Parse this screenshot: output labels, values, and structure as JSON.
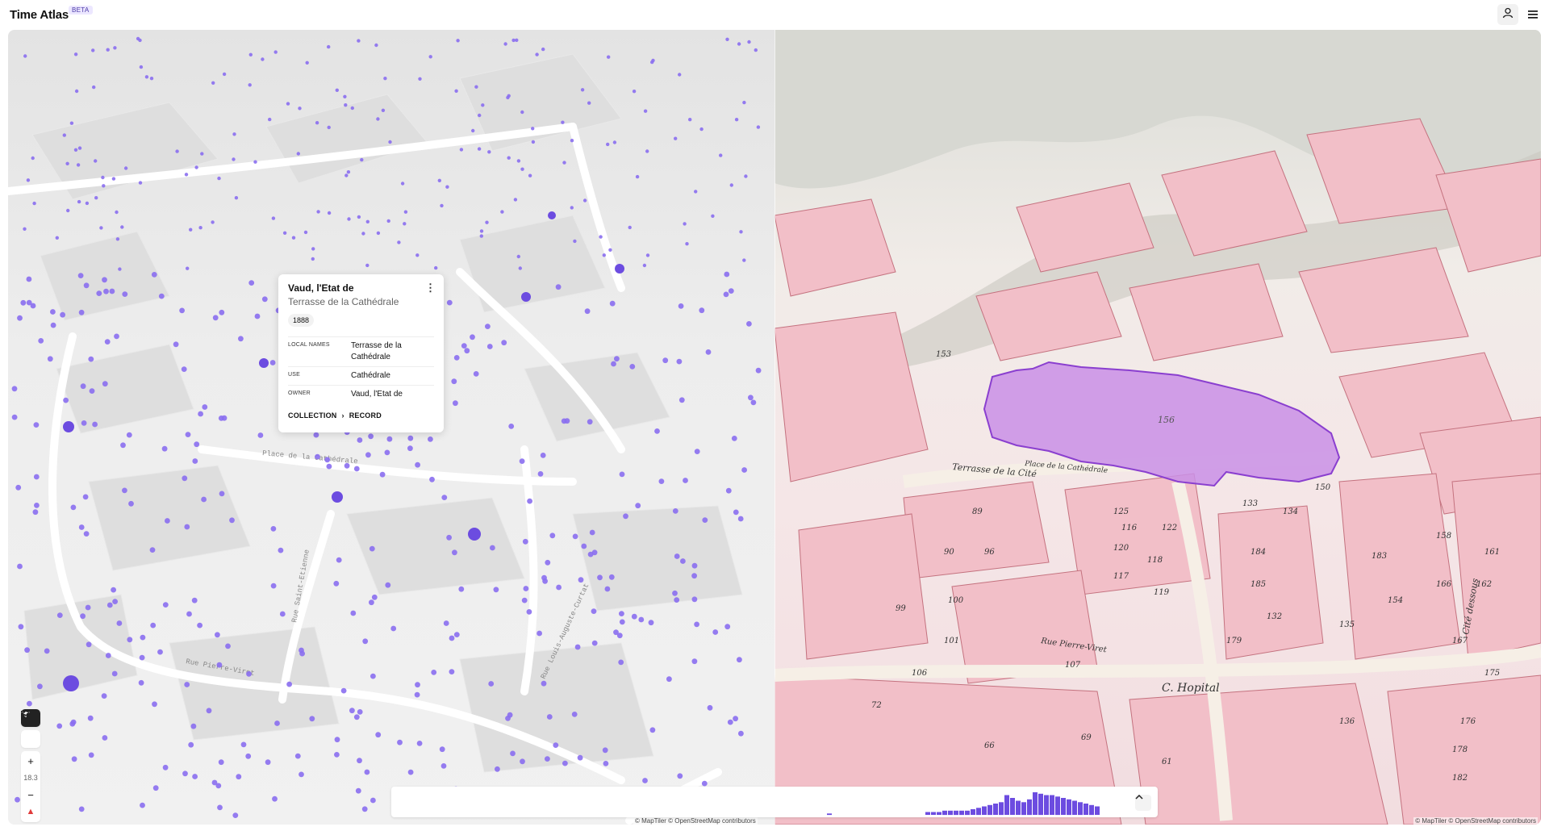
{
  "header": {
    "brand": "Time Atlas",
    "badge": "BETA",
    "user_icon": "user-icon",
    "menu_icon": "hamburger-menu-icon"
  },
  "popup": {
    "title": "Vaud, l'Etat de",
    "subtitle": "Terrasse de la Cathédrale",
    "year": "1888",
    "rows": [
      {
        "key": "LOCAL NAMES",
        "value": "Terrasse de la Cathédrale"
      },
      {
        "key": "USE",
        "value": "Cathédrale"
      },
      {
        "key": "OWNER",
        "value": "Vaud, l'Etat de"
      }
    ],
    "link_collection": "COLLECTION",
    "link_record": "RECORD"
  },
  "toolbar": {
    "zoom_in": "+",
    "zoom_level": "18.3",
    "zoom_out": "−"
  },
  "left_map": {
    "street_labels": [
      "Place de la Cathédrale",
      "Rue Pierre-Viret",
      "Rue Saint-Etienne",
      "Rue Louis-Auguste-Curtat"
    ],
    "attribution": "© MapTiler © OpenStreetMap contributors"
  },
  "right_map": {
    "labels": [
      "Terrasse de la Cité",
      "Place de la Cathédrale",
      "Rue Pierre-Viret",
      "C. Hopital",
      "Cité dessous"
    ],
    "parcels": [
      "89",
      "90",
      "96",
      "100",
      "99",
      "101",
      "107",
      "106",
      "72",
      "69",
      "66",
      "61",
      "125",
      "120",
      "117",
      "118",
      "119",
      "122",
      "116",
      "150",
      "158",
      "161",
      "162",
      "166",
      "167",
      "175",
      "176",
      "178",
      "182",
      "183",
      "184",
      "185",
      "179",
      "132",
      "133",
      "134",
      "135",
      "136",
      "153",
      "154"
    ],
    "highlight_label": "156",
    "attribution": "© MapTiler © OpenStreetMap contributors"
  },
  "timeline": {
    "histogram": [
      1,
      0,
      0,
      0,
      0,
      0,
      0,
      0,
      0,
      0,
      0,
      0,
      0,
      0,
      0,
      0,
      0,
      0,
      0,
      0,
      0,
      2,
      2,
      2,
      3,
      3,
      3,
      3,
      3,
      4,
      5,
      6,
      7,
      8,
      9,
      14,
      12,
      10,
      9,
      11,
      16,
      15,
      14,
      14,
      13,
      12,
      11,
      10,
      9,
      8,
      7,
      6
    ],
    "toggle_icon": "chevron-up-icon"
  },
  "colors": {
    "accent": "#6c4ce0",
    "dot": "#8a6ef0",
    "parcel_pink": "#f2bfc8",
    "highlight": "#c98fe6"
  }
}
